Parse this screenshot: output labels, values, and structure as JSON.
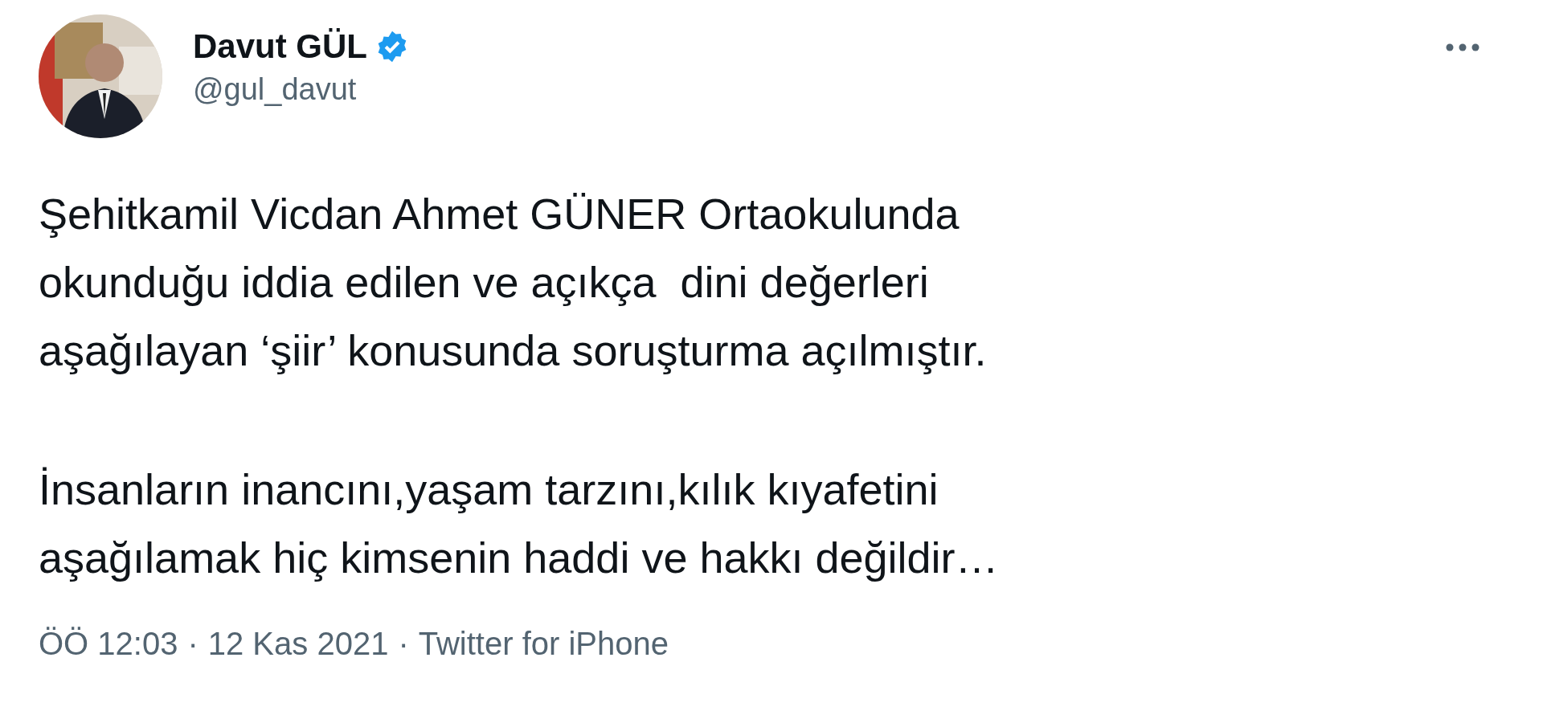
{
  "author": {
    "name": "Davut GÜL",
    "verified": true,
    "handle": "@gul_davut"
  },
  "paragraphs": [
    [
      "Şehitkamil Vicdan Ahmet GÜNER Ortaokulunda",
      "okunduğu iddia edilen ve açıkça  dini değerleri",
      "aşağılayan ‘şiir’ konusunda soruşturma açılmıştır."
    ],
    [
      "İnsanların inancını,yaşam tarzını,kılık kıyafetini",
      "aşağılamak hiç kimsenin haddi ve hakkı değildir…"
    ]
  ],
  "footer": {
    "time": "ÖÖ 12:03",
    "date": "12 Kas 2021",
    "separator": "·",
    "source": "Twitter for iPhone"
  }
}
